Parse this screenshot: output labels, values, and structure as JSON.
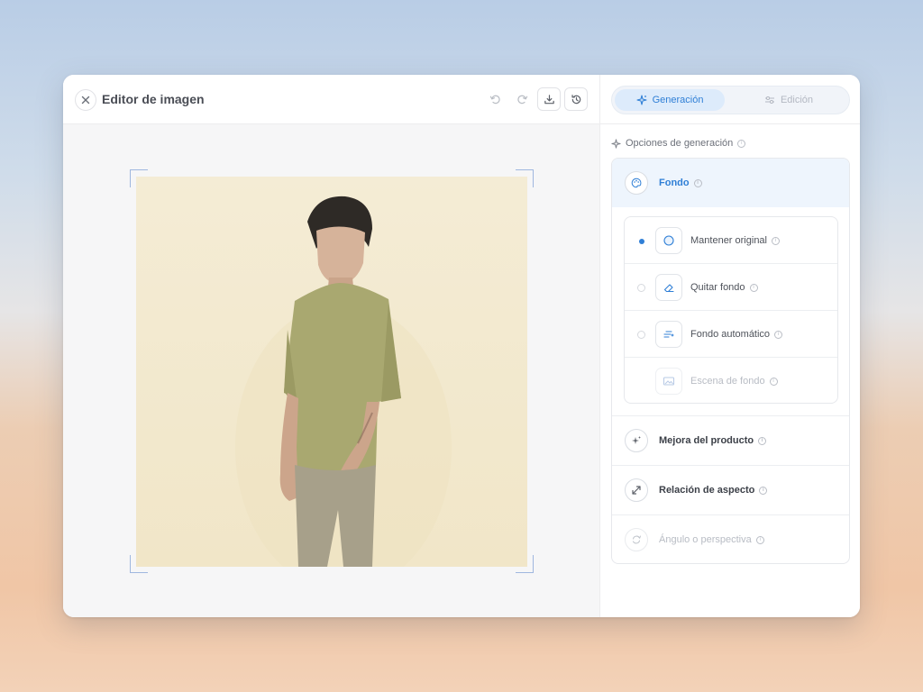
{
  "window": {
    "title": "Editor de imagen"
  },
  "toolbar": {
    "close_icon": "close-icon",
    "undo_icon": "undo-icon",
    "redo_icon": "redo-icon",
    "download_icon": "download-icon",
    "history_icon": "history-icon"
  },
  "tabs": [
    {
      "label": "Generación",
      "icon": "sparkle-icon",
      "active": true
    },
    {
      "label": "Edición",
      "icon": "sliders-icon",
      "active": false
    }
  ],
  "section": {
    "title": "Opciones de generación"
  },
  "fondo": {
    "label": "Fondo",
    "options": [
      {
        "label": "Mantener original",
        "selected": true,
        "disabled": false
      },
      {
        "label": "Quitar fondo",
        "selected": false,
        "disabled": false
      },
      {
        "label": "Fondo automático",
        "selected": false,
        "disabled": false
      },
      {
        "label": "Escena de fondo",
        "selected": false,
        "disabled": true
      }
    ]
  },
  "rows": [
    {
      "label": "Mejora del producto",
      "disabled": false
    },
    {
      "label": "Relación de aspecto",
      "disabled": false
    },
    {
      "label": "Ángulo o perspectiva",
      "disabled": true
    }
  ],
  "colors": {
    "accent": "#2f7fd6",
    "accent_bg": "#eef5fd"
  }
}
